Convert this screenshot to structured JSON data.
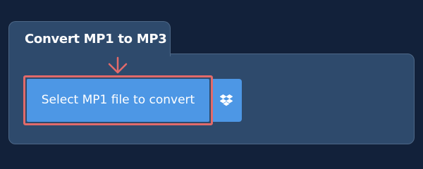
{
  "tab": {
    "title": "Convert MP1 to MP3"
  },
  "uploader": {
    "select_label": "Select MP1 file to convert",
    "dropbox_icon": "dropbox-icon",
    "pointer_icon": "arrow-down-icon"
  },
  "colors": {
    "background": "#12213a",
    "panel": "#2e4a6c",
    "button": "#4d97e5",
    "highlight": "#e26a6a"
  }
}
